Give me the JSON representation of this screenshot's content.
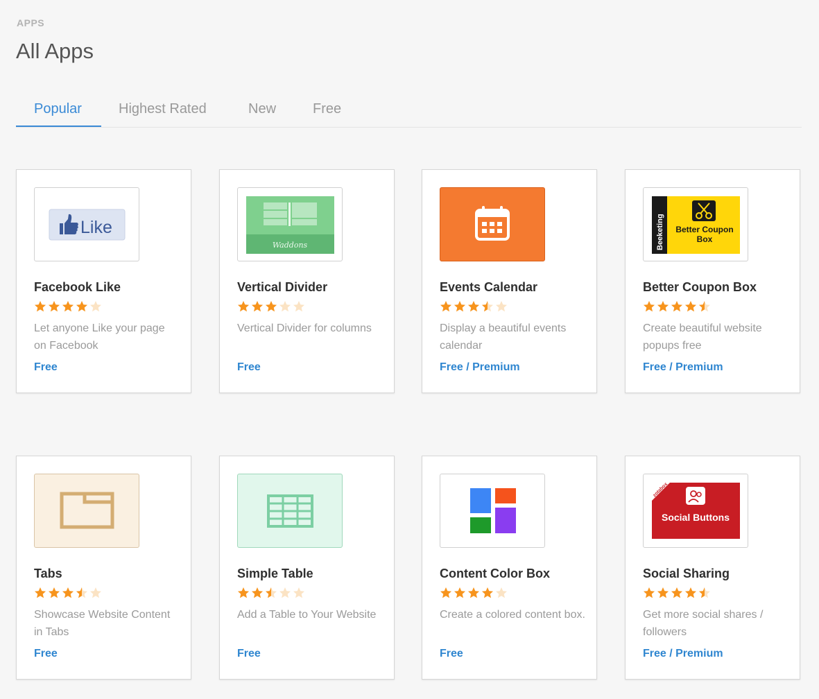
{
  "breadcrumb": "APPS",
  "page_title": "All Apps",
  "tabs": [
    {
      "label": "Popular",
      "active": true
    },
    {
      "label": "Highest Rated",
      "active": false
    },
    {
      "label": "New",
      "active": false
    },
    {
      "label": "Free",
      "active": false
    }
  ],
  "colors": {
    "accent": "#3a8ad6",
    "star": "#f7941d",
    "star_empty": "#fbe3c4",
    "price": "#2f86d0"
  },
  "apps": [
    {
      "name": "Facebook Like",
      "rating": 4,
      "description": "Let anyone Like your page on Facebook",
      "price": "Free",
      "icon": "facebook-like-logo",
      "thumb_text": "Like"
    },
    {
      "name": "Vertical Divider",
      "rating": 3,
      "description": "Vertical Divider for columns",
      "price": "Free",
      "icon": "waddons-divider-thumbnail",
      "thumb_text": "Waddons"
    },
    {
      "name": "Events Calendar",
      "rating": 3.5,
      "description": "Display a beautiful events calendar",
      "price": "Free / Premium",
      "icon": "calendar-icon"
    },
    {
      "name": "Better Coupon Box",
      "rating": 4.5,
      "description": "Create beautiful website popups free",
      "price": "Free / Premium",
      "icon": "coupon-scissors-icon",
      "thumb_text": "Better Coupon Box",
      "thumb_brand": "Beeketing"
    },
    {
      "name": "Tabs",
      "rating": 3.5,
      "description": "Showcase Website Content in Tabs",
      "price": "Free",
      "icon": "tabs-icon"
    },
    {
      "name": "Simple Table",
      "rating": 2.5,
      "description": "Add a Table to Your Website",
      "price": "Free",
      "icon": "table-grid-icon"
    },
    {
      "name": "Content Color Box",
      "rating": 4,
      "description": "Create a colored content box.",
      "price": "Free",
      "icon": "color-blocks-icon"
    },
    {
      "name": "Social Sharing",
      "rating": 4.5,
      "description": "Get more social shares / followers",
      "price": "Free / Premium",
      "icon": "social-buttons-icon",
      "thumb_text": "Social Buttons",
      "thumb_brand": "zotabox"
    }
  ]
}
